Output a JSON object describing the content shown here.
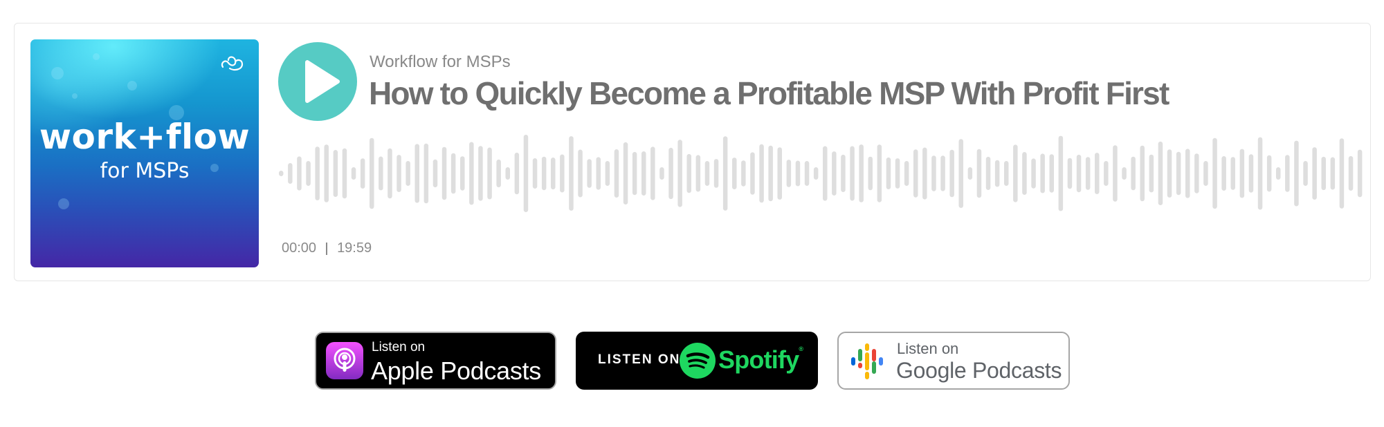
{
  "player": {
    "cover": {
      "line1": "work+flow",
      "line2": "for MSPs"
    },
    "show_name": "Workflow for MSPs",
    "episode_title": "How to Quickly Become a Profitable MSP With Profit First",
    "time": {
      "current": "00:00",
      "duration": "19:59"
    },
    "progress_fraction": 0.0,
    "accent_color": "#56cbc4",
    "waveform_color": "#dedede"
  },
  "badges": {
    "apple": {
      "small": "Listen on",
      "big": "Apple Podcasts"
    },
    "spotify": {
      "listen": "LISTEN ON",
      "brand": "Spotify",
      "tm": "®"
    },
    "google": {
      "small": "Listen on",
      "big": "Google Podcasts"
    }
  },
  "icons": [
    "play-icon",
    "brand-mark-icon",
    "apple-podcasts-icon",
    "spotify-icon",
    "google-podcasts-icon"
  ]
}
